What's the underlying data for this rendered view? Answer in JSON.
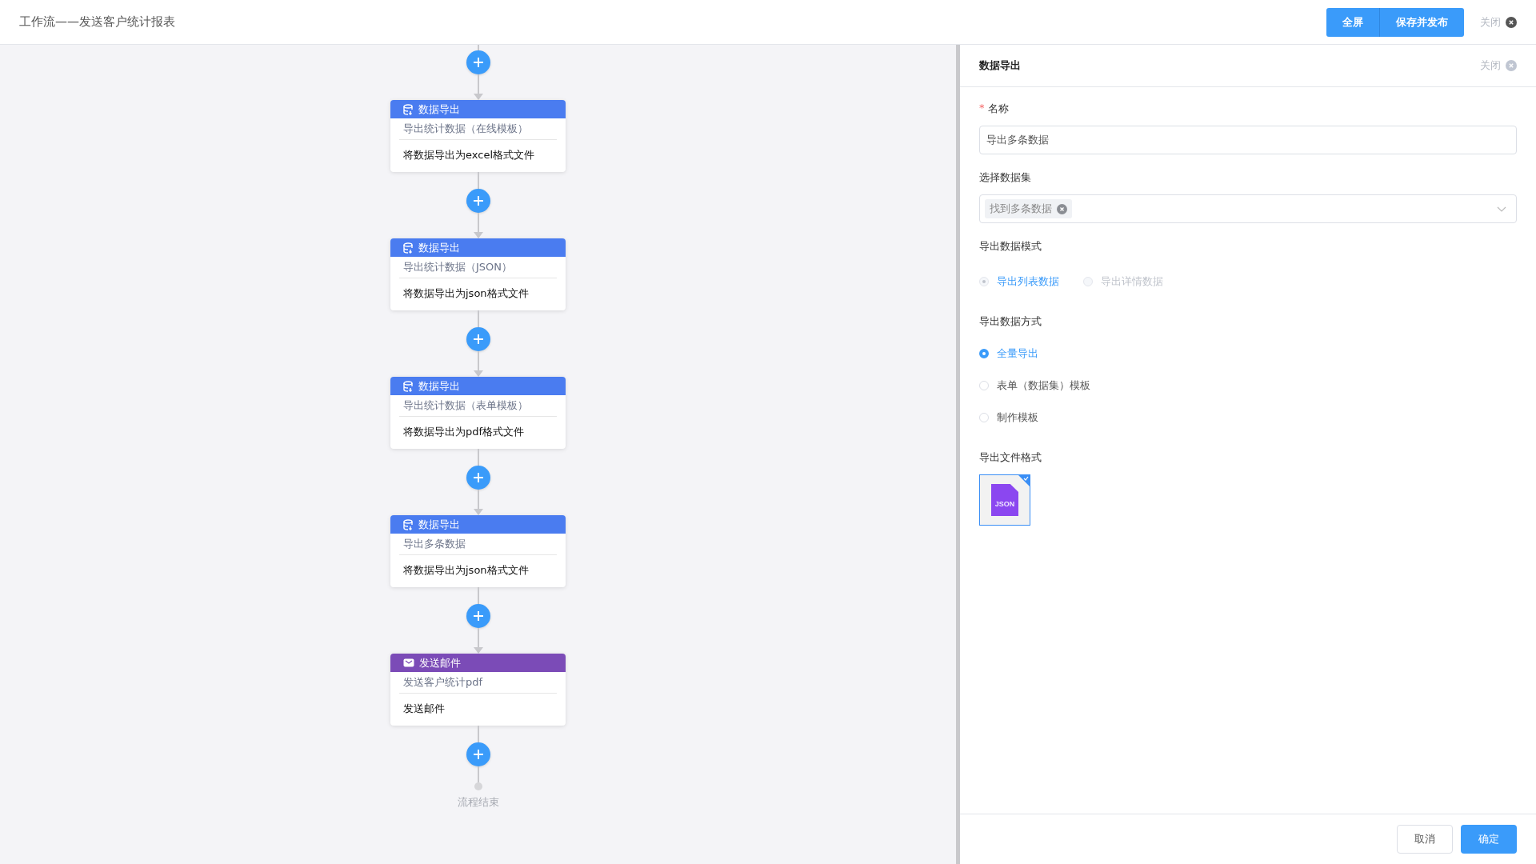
{
  "header": {
    "title": "工作流——发送客户统计报表",
    "buttons": [
      {
        "label": "全屏"
      },
      {
        "label": "保存并发布"
      }
    ],
    "close": "关闭"
  },
  "flow": {
    "nodes": [
      {
        "kind": "export",
        "type_label": "数据导出",
        "name": "导出统计数据（在线模板）",
        "description": "将数据导出为excel格式文件"
      },
      {
        "kind": "export",
        "type_label": "数据导出",
        "name": "导出统计数据（JSON）",
        "description": "将数据导出为json格式文件"
      },
      {
        "kind": "export",
        "type_label": "数据导出",
        "name": "导出统计数据（表单模板）",
        "description": "将数据导出为pdf格式文件"
      },
      {
        "kind": "export",
        "type_label": "数据导出",
        "name": "导出多条数据",
        "description": "将数据导出为json格式文件"
      },
      {
        "kind": "email",
        "type_label": "发送邮件",
        "name": "发送客户统计pdf",
        "description": "发送邮件"
      }
    ],
    "end_label": "流程结束"
  },
  "panel": {
    "title": "数据导出",
    "close": "关闭",
    "name_field": {
      "label": "名称",
      "required_mark": "*",
      "value": "导出多条数据"
    },
    "dataset_field": {
      "label": "选择数据集",
      "tags": [
        "找到多条数据"
      ]
    },
    "mode": {
      "label": "导出数据模式",
      "disabled": true,
      "options": [
        {
          "label": "导出列表数据",
          "selected": true
        },
        {
          "label": "导出详情数据",
          "selected": false
        }
      ]
    },
    "method": {
      "label": "导出数据方式",
      "disabled": false,
      "options": [
        {
          "label": "全量导出",
          "selected": true
        },
        {
          "label": "表单（数据集）模板",
          "selected": false
        },
        {
          "label": "制作模板",
          "selected": false
        }
      ]
    },
    "format": {
      "label": "导出文件格式",
      "options": [
        {
          "label": "JSON",
          "selected": true
        }
      ]
    },
    "footer_buttons": [
      {
        "label": "取消",
        "primary": false
      },
      {
        "label": "确定",
        "primary": true
      }
    ]
  }
}
